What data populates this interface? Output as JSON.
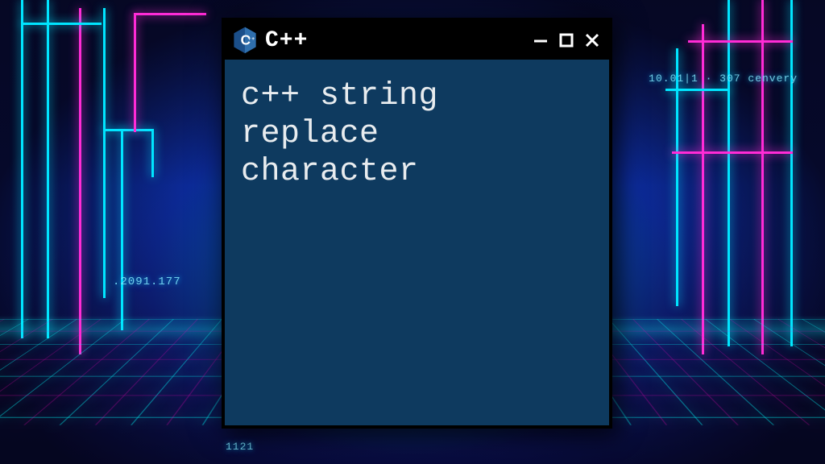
{
  "window": {
    "title": "C++",
    "content": "c++ string\nreplace\ncharacter",
    "icon_name": "cpp-logo-icon"
  },
  "background": {
    "deco_text_left": ".2091.177",
    "deco_text_right": "10.01|1 · 307  cenvery",
    "deco_text_bottom": "1121"
  },
  "colors": {
    "window_bg": "#0e3a5f",
    "titlebar_bg": "#000000",
    "neon_cyan": "#00e5ff",
    "neon_magenta": "#ff2bd6"
  }
}
